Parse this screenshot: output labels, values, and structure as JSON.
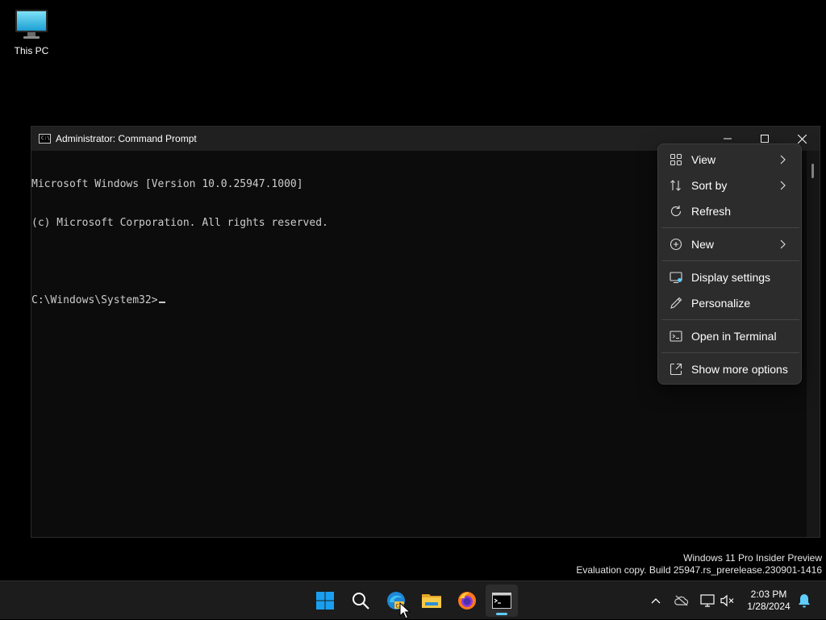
{
  "desktop": {
    "icons": [
      {
        "label": "This PC",
        "icon": "computer-icon"
      }
    ]
  },
  "window": {
    "title": "Administrator: Command Prompt",
    "console_lines": [
      "Microsoft Windows [Version 10.0.25947.1000]",
      "(c) Microsoft Corporation. All rights reserved.",
      "",
      "C:\\Windows\\System32>"
    ],
    "controls": {
      "minimize": "minimize-icon",
      "maximize": "maximize-icon",
      "close": "close-icon"
    }
  },
  "context_menu": {
    "items": [
      {
        "label": "View",
        "icon": "grid-icon",
        "submenu": true
      },
      {
        "label": "Sort by",
        "icon": "sort-icon",
        "submenu": true
      },
      {
        "label": "Refresh",
        "icon": "refresh-icon",
        "submenu": false
      },
      {
        "label": "New",
        "icon": "plus-circle-icon",
        "submenu": true
      },
      {
        "label": "Display settings",
        "icon": "display-icon",
        "submenu": false
      },
      {
        "label": "Personalize",
        "icon": "pen-icon",
        "submenu": false
      },
      {
        "label": "Open in Terminal",
        "icon": "terminal-icon",
        "submenu": false
      },
      {
        "label": "Show more options",
        "icon": "expand-icon",
        "submenu": false
      }
    ]
  },
  "watermark": {
    "line1": "Windows 11 Pro Insider Preview",
    "line2": "Evaluation copy. Build 25947.rs_prerelease.230901-1416"
  },
  "taskbar": {
    "apps": [
      "start-icon",
      "search-icon",
      "edge-canary-icon",
      "file-explorer-icon",
      "firefox-icon",
      "command-prompt-icon"
    ],
    "active_app": "command-prompt-icon",
    "tray": [
      "chevron-up-icon",
      "onedrive-icon",
      "network-icon",
      "volume-muted-icon",
      "notification-bell-icon"
    ],
    "clock": {
      "time": "2:03 PM",
      "date": "1/28/2024"
    }
  },
  "colors": {
    "accent": "#60cdff",
    "console_bg": "#0c0c0c",
    "console_text": "#cccccc",
    "menu_bg": "#2c2c2c",
    "taskbar_bg": "#1c1c1c"
  }
}
